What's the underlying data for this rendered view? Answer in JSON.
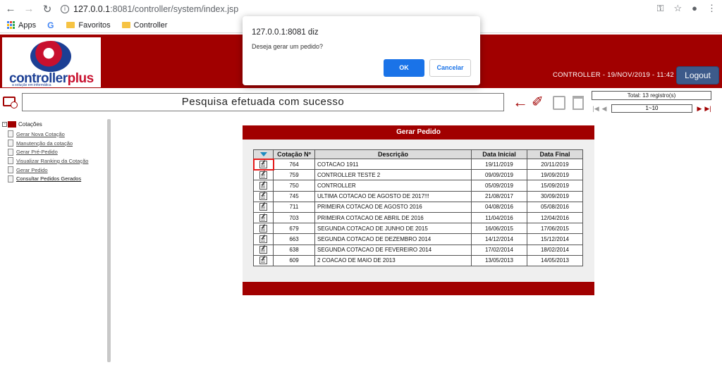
{
  "browser": {
    "url_host": "127.0.0.1",
    "url_path": ":8081/controller/system/index.jsp",
    "bookmarks": [
      "Apps",
      "Favoritos",
      "Controller"
    ]
  },
  "header": {
    "logo_text_a": "controller",
    "logo_text_b": "plus",
    "logo_tagline": "a solução em informática",
    "info": "CONTROLLER - 19/NOV/2019 - 11:42",
    "logout_label": "Logout"
  },
  "toolbar": {
    "status_message": "Pesquisa efetuada com sucesso",
    "total_label": "Total: 13 registro(s)",
    "page_label": "1~10"
  },
  "sidebar": {
    "root_label": "Cotações",
    "items": [
      "Gerar Nova Cotação",
      "Manutenção da cotação",
      "Gerar Pré-Pedido",
      "Visualizar Ranking da Cotação",
      "Gerar Pedido",
      "Consultar Pedidos Gerados"
    ]
  },
  "panel": {
    "title": "Gerar Pedido",
    "columns": [
      "Cotação Nº",
      "Descrição",
      "Data Inicial",
      "Data Final"
    ],
    "rows": [
      {
        "num": "764",
        "desc": "COTACAO 1911",
        "start": "19/11/2019",
        "end": "20/11/2019"
      },
      {
        "num": "759",
        "desc": "CONTROLLER TESTE 2",
        "start": "09/09/2019",
        "end": "19/09/2019"
      },
      {
        "num": "750",
        "desc": "CONTROLLER",
        "start": "05/09/2019",
        "end": "15/09/2019"
      },
      {
        "num": "745",
        "desc": "ULTIMA COTACAO DE AGOSTO DE 2017!!!",
        "start": "21/08/2017",
        "end": "30/09/2019"
      },
      {
        "num": "711",
        "desc": "PRIMEIRA COTACAO DE AGOSTO 2016",
        "start": "04/08/2016",
        "end": "05/08/2016"
      },
      {
        "num": "703",
        "desc": "PRIMEIRA COTACAO DE ABRIL DE 2016",
        "start": "11/04/2016",
        "end": "12/04/2016"
      },
      {
        "num": "679",
        "desc": "SEGUNDA COTACAO DE JUNHO DE 2015",
        "start": "16/06/2015",
        "end": "17/06/2015"
      },
      {
        "num": "663",
        "desc": "SEGUNDA COTACAO DE DEZEMBRO 2014",
        "start": "14/12/2014",
        "end": "15/12/2014"
      },
      {
        "num": "638",
        "desc": "SEGUNDA COTACAO DE FEVEREIRO 2014",
        "start": "17/02/2014",
        "end": "18/02/2014"
      },
      {
        "num": "609",
        "desc": "2 COACAO DE MAIO DE 2013",
        "start": "13/05/2013",
        "end": "14/05/2013"
      }
    ]
  },
  "dialog": {
    "title": "127.0.0.1:8081 diz",
    "message": "Deseja gerar um pedido?",
    "ok_label": "OK",
    "cancel_label": "Cancelar"
  },
  "colors": {
    "brand_red": "#a10000",
    "logout_blue": "#3d5a8a",
    "dialog_ok_blue": "#1a73e8",
    "highlight_red": "#e31b1b"
  }
}
